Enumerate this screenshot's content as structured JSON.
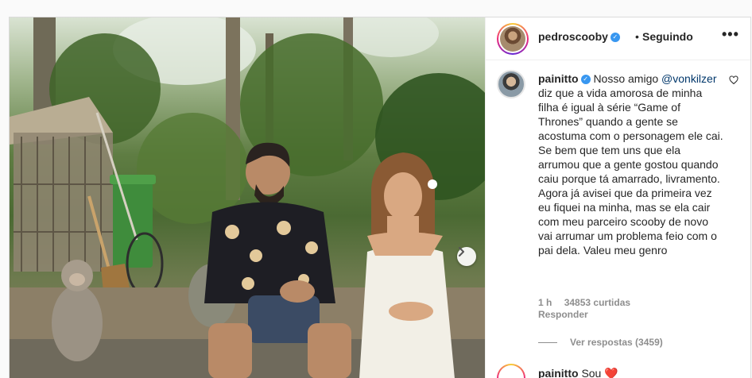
{
  "photo": {
    "alt": "",
    "next_icon": "chevron-right-icon"
  },
  "header": {
    "username": "pedroscooby",
    "verified_icon": "verified-badge-icon",
    "separator": "•",
    "follow_status": "Seguindo",
    "more_icon": "more-options-icon",
    "more_label": "•••"
  },
  "comment": {
    "username": "painitto",
    "text_part1": "Nosso amigo",
    "mention": "@vonkilzer",
    "text_part2": "diz que a vida amorosa de minha filha é igual à série “Game of Thrones” quando a gente se acostuma com o personagem ele cai. Se bem que tem uns que ela arrumou que a gente gostou quando caiu porque tá amarrado, livramento. Agora já avisei que da primeira vez eu fiquei na minha, mas se ela cair com meu parceiro scooby de novo vai arrumar um problema feio com o pai dela. Valeu meu genro",
    "time": "1 h",
    "likes": "34853 curtidas",
    "reply_label": "Responder",
    "view_replies": "Ver respostas (3459)"
  },
  "next_comment": {
    "username": "painitto",
    "text_snippet": "Sou ❤️"
  },
  "colors": {
    "link": "#00376b",
    "verified": "#3897f0",
    "muted": "#8e8e8e",
    "text": "#262626",
    "border": "#dbdbdb"
  }
}
